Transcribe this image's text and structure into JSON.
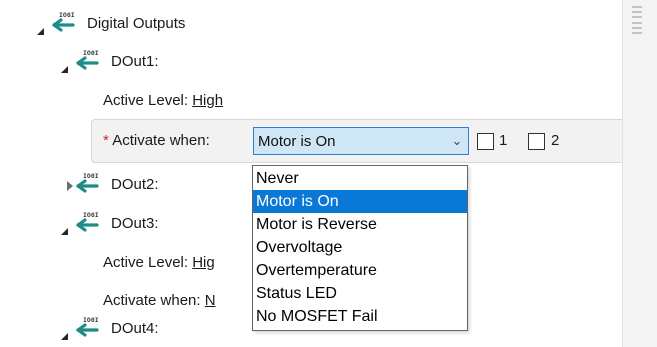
{
  "tree": {
    "root": {
      "label": "Digital Outputs",
      "icon": "digital-io-icon",
      "expanded": true
    },
    "dout1": {
      "label": "DOut1:",
      "expanded": true,
      "active_level_label": "Active Level:",
      "active_level_value": "High",
      "activate_when_required_mark": "*",
      "activate_when_label": "Activate when:",
      "activate_when_value": "Motor is On",
      "checkbox_1_label": "1",
      "checkbox_2_label": "2"
    },
    "dout2": {
      "label": "DOut2:",
      "expanded": false
    },
    "dout3": {
      "label": "DOut3:",
      "expanded": true,
      "active_level_label": "Active Level:",
      "active_level_value": "Hig",
      "activate_when_label": "Activate when:",
      "activate_when_value": "N"
    },
    "dout4": {
      "label": "DOut4:",
      "expanded": true
    }
  },
  "dropdown": {
    "options": [
      "Never",
      "Motor is On",
      "Motor is Reverse",
      "Overvoltage",
      "Overtemperature",
      "Status LED",
      "No MOSFET Fail"
    ],
    "selected_index": 1
  },
  "colors": {
    "icon_teal": "#1f8a8a",
    "selection_blue": "#0a78d7",
    "combo_fill": "#cfe6f7",
    "combo_border": "#2f7fd3",
    "required_red": "#d12b2b"
  }
}
